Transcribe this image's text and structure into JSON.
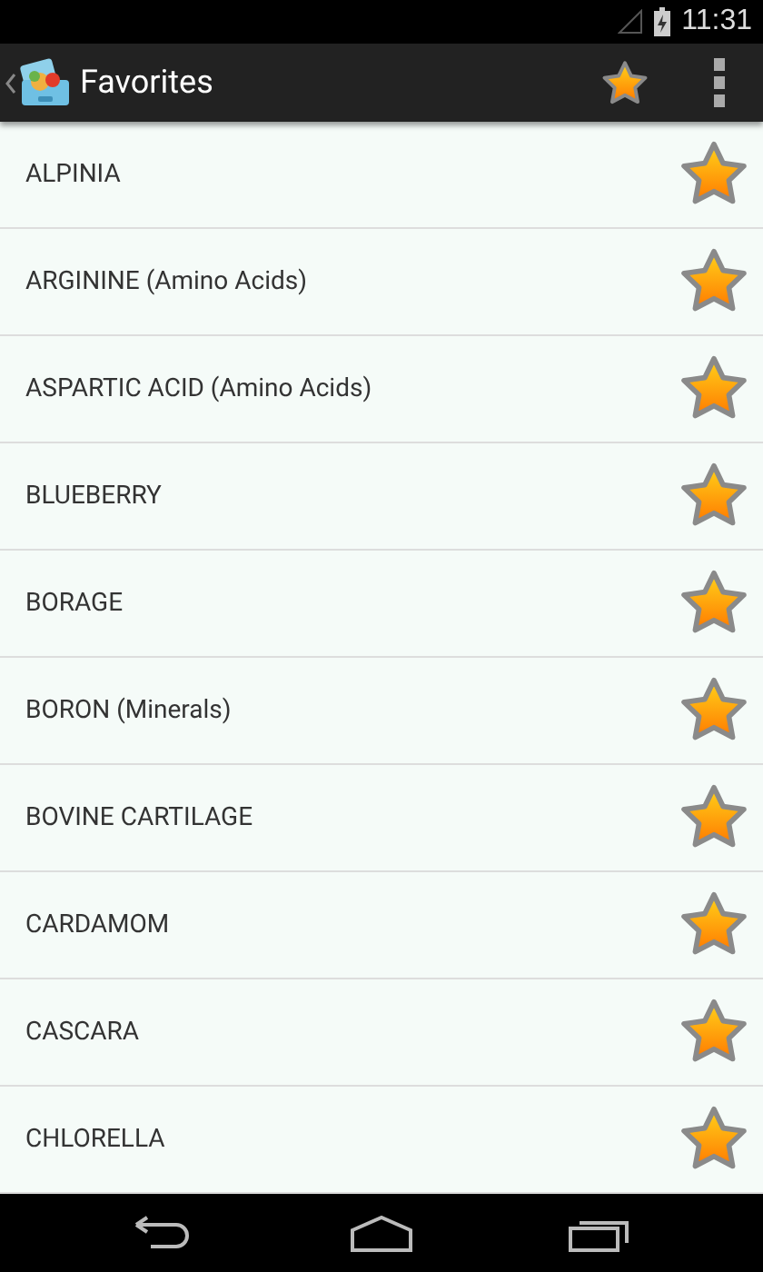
{
  "status_bar": {
    "time": "11:31"
  },
  "action_bar": {
    "title": "Favorites"
  },
  "items": [
    {
      "name": "ALPINIA",
      "starred": true
    },
    {
      "name": "ARGININE (Amino Acids)",
      "starred": true
    },
    {
      "name": "ASPARTIC ACID (Amino Acids)",
      "starred": true
    },
    {
      "name": "BLUEBERRY",
      "starred": true
    },
    {
      "name": "BORAGE",
      "starred": true
    },
    {
      "name": "BORON (Minerals)",
      "starred": true
    },
    {
      "name": "BOVINE CARTILAGE",
      "starred": true
    },
    {
      "name": "CARDAMOM",
      "starred": true
    },
    {
      "name": "CASCARA",
      "starred": true
    },
    {
      "name": "CHLORELLA",
      "starred": true
    }
  ]
}
